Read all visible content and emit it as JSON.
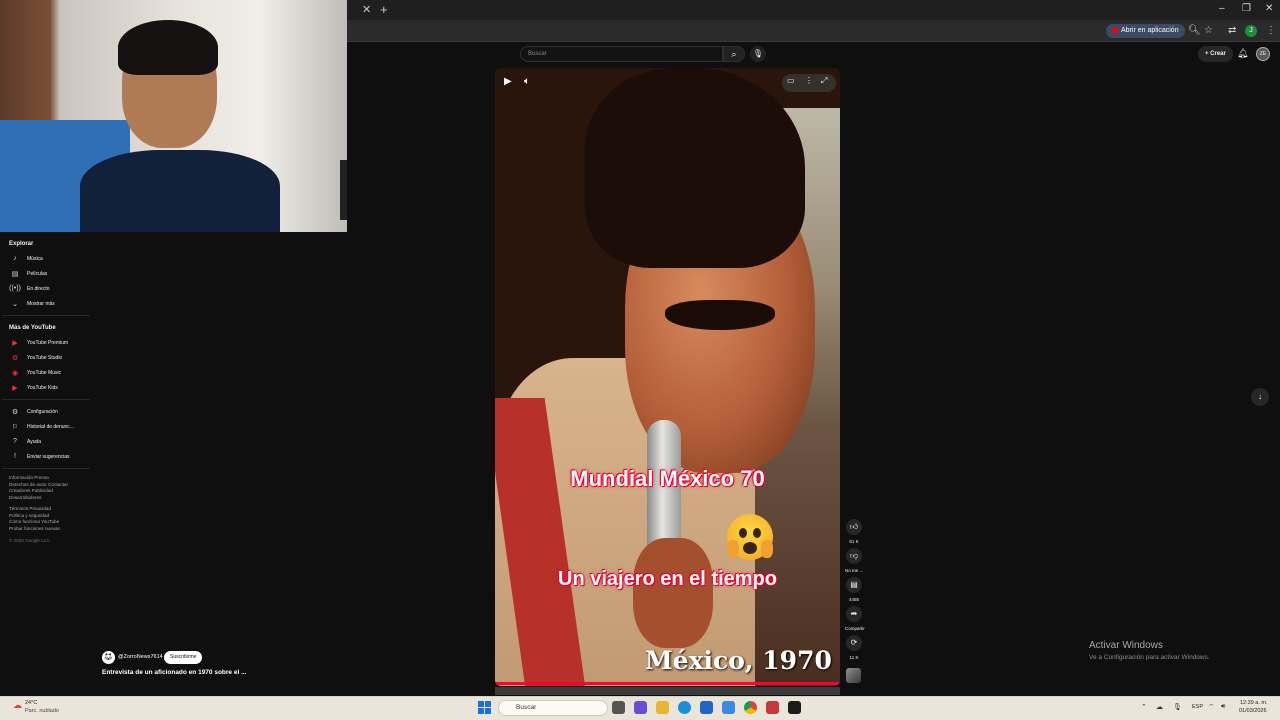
{
  "browser": {
    "open_in_app": "Abrir en aplicación",
    "profile_initial": "J"
  },
  "header": {
    "search_placeholder": "Buscar",
    "create_label": "Crear",
    "avatar_label": "ZE"
  },
  "sidebar": {
    "explore_heading": "Explorar",
    "explore_items": [
      {
        "label": "Música",
        "icon": "music-note-icon"
      },
      {
        "label": "Películas",
        "icon": "film-icon"
      },
      {
        "label": "En directo",
        "icon": "live-icon"
      },
      {
        "label": "Mostrar más",
        "icon": "chevron-down-icon"
      }
    ],
    "more_heading": "Más de YouTube",
    "more_items": [
      {
        "label": "YouTube Premium",
        "icon": "youtube-premium-icon"
      },
      {
        "label": "YouTube Studio",
        "icon": "youtube-studio-icon"
      },
      {
        "label": "YouTube Music",
        "icon": "youtube-music-icon"
      },
      {
        "label": "YouTube Kids",
        "icon": "youtube-kids-icon"
      }
    ],
    "settings_items": [
      {
        "label": "Configuración",
        "icon": "gear-icon"
      },
      {
        "label": "Historial de denunc...",
        "icon": "flag-icon"
      },
      {
        "label": "Ayuda",
        "icon": "help-icon"
      },
      {
        "label": "Enviar sugerencias",
        "icon": "feedback-icon"
      }
    ],
    "footer_line1": "Información  Prensa",
    "footer_line2": "Derechos de autor  Contactar",
    "footer_line3": "Creadores  Publicidad",
    "footer_line4": "Desarrolladores",
    "footer_line5": "Términos  Privacidad",
    "footer_line6": "Política y seguridad",
    "footer_line7": "Cómo funciona YouTube",
    "footer_line8": "Probar funciones nuevas",
    "copyright": "© 2026 Google LLC"
  },
  "video": {
    "caption1": "Mundial México 70",
    "caption2": "Un viajero en el tiempo",
    "stamp": "México, 1970",
    "progress_fraction": 1.0
  },
  "actions": {
    "likes": "61 K",
    "dislike_label": "No me ...",
    "comments": "4455",
    "share_label": "Compartir",
    "remix_count": "11 K"
  },
  "channel": {
    "handle": "@ZorroNews7614",
    "subscribe_label": "Suscribirme",
    "video_title": "Entrevista de un aficionado en 1970 sobre el ..."
  },
  "activation": {
    "title": "Activar Windows",
    "subtitle": "Ve a Configuración para activar Windows."
  },
  "taskbar": {
    "temperature": "24°C",
    "weather": "Parc. nublado",
    "search_label": "Buscar",
    "language": "ESP",
    "time": "12:39 a. m.",
    "date": "01/03/2026"
  }
}
